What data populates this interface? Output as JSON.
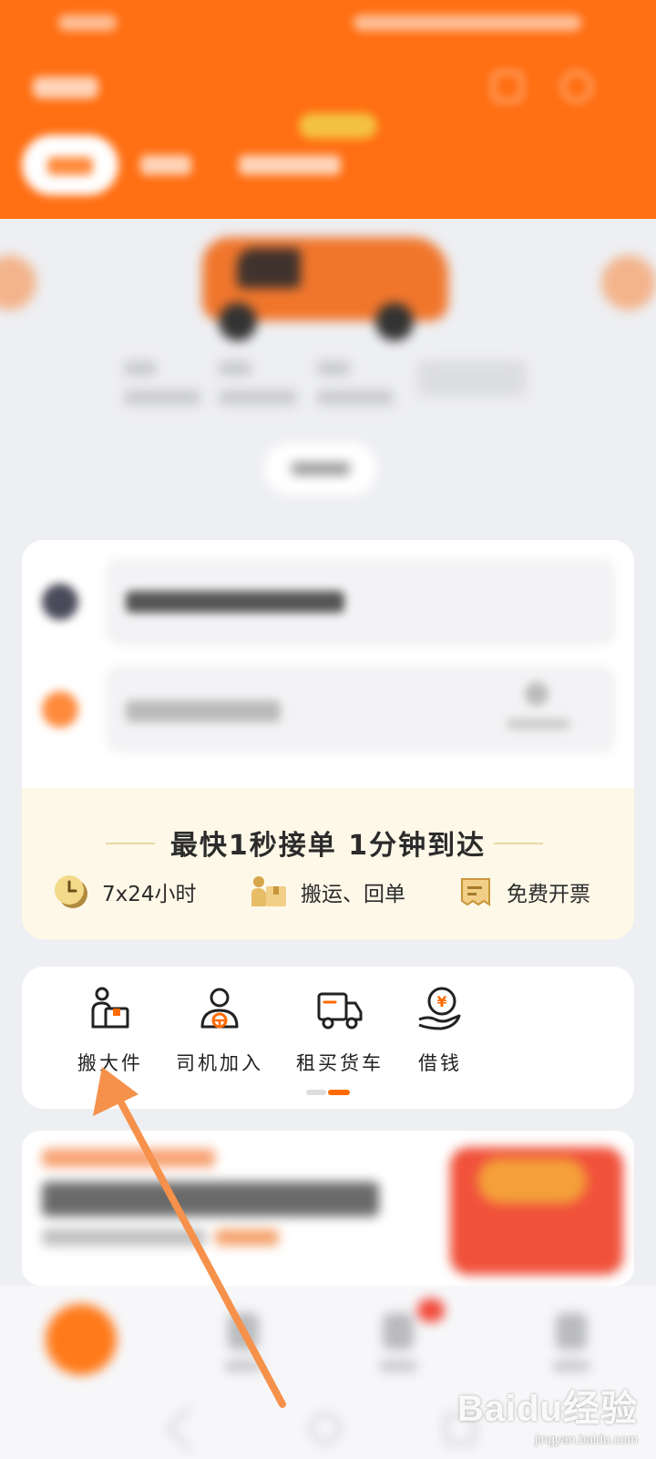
{
  "promo": {
    "headline": "最快1秒接单 1分钟到达",
    "features": [
      {
        "icon": "clock-icon",
        "label": "7x24小时"
      },
      {
        "icon": "porter-box-icon",
        "label": "搬运、回单"
      },
      {
        "icon": "invoice-icon",
        "label": "免费开票"
      }
    ]
  },
  "services": {
    "items": [
      {
        "icon": "moving-box-icon",
        "label": "搬大件"
      },
      {
        "icon": "driver-icon",
        "label": "司机加入"
      },
      {
        "icon": "truck-icon",
        "label": "租买货车"
      },
      {
        "icon": "loan-coin-icon",
        "label": "借钱"
      }
    ],
    "active_page": 2,
    "page_count": 2
  },
  "colors": {
    "brand_orange": "#ff6f13",
    "promo_bg": "#fdf8e8",
    "arrow": "#f5914a",
    "icon_accent": "#ff6a00"
  },
  "watermark": {
    "brand": "Baidu经验",
    "url": "jingyan.baidu.com"
  }
}
